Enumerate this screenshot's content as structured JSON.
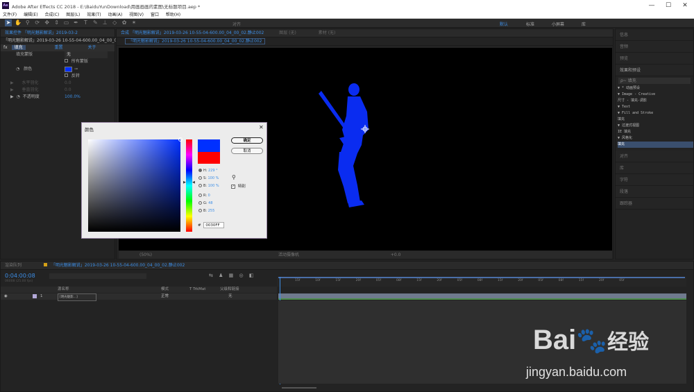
{
  "window": {
    "title": "Adobe After Effects CC 2018 - E:\\BaiduYunDownload\\用画画画的素图\\无标题项目.aep *",
    "minimize": "—",
    "maximize": "☐",
    "close": "✕"
  },
  "menu": [
    "文件(F)",
    "编辑(E)",
    "合成(C)",
    "图层(L)",
    "效果(T)",
    "动画(A)",
    "视图(V)",
    "窗口",
    "帮助(H)"
  ],
  "toolbar": {
    "icons": [
      "arrow-icon",
      "hand-icon",
      "zoom-icon",
      "orbit-icon",
      "pan-icon",
      "dolly-icon",
      "rect-icon",
      "pen-icon",
      "text-icon",
      "brush-icon",
      "stamp-icon",
      "eraser-icon",
      "roto-icon",
      "puppet-icon"
    ],
    "snap_label": "对齐",
    "workspaces": [
      "默认",
      "标准",
      "小屏幕",
      "库"
    ]
  },
  "effects_panel": {
    "tab": "效果控件 「明光魅影解说」2019-03-2",
    "layer": "「明光魅影解说」2019-03-26 10-55-04-600.00_04_00_02.静止",
    "effect_name": "填充",
    "reset": "重置",
    "about": "关于",
    "rows": [
      {
        "label": "填充蒙版",
        "value": "无"
      },
      {
        "label": "",
        "value": "所有蒙版"
      },
      {
        "label": "颜色",
        "value": ""
      },
      {
        "label": "",
        "value": "反转"
      },
      {
        "label": "水平羽化",
        "value": "0.0"
      },
      {
        "label": "垂直羽化",
        "value": "0.0"
      },
      {
        "label": "不透明度",
        "value": "100.0%"
      }
    ]
  },
  "composition": {
    "tab": "合成 「明光魅影解说」2019-03-26 10-55-04-600.00_04_00_02.静止002",
    "layer_tab": "图层 (无)",
    "footage_tab": "素材 (无)",
    "subtab": "「明光魅影解说」2019-03-26 10-55-04-600.00_04_00_02.静止002",
    "zoom": "(50%)",
    "bottom_text": "活动摄像机",
    "plus": "+0.0"
  },
  "color_dialog": {
    "title": "颜色",
    "close": "✕",
    "ok": "确定",
    "cancel": "取消",
    "new_color": "#0030FF",
    "old_color": "#FF0000",
    "fields": [
      {
        "label": "H:",
        "value": "229 °"
      },
      {
        "label": "S:",
        "value": "100 %"
      },
      {
        "label": "B:",
        "value": "100 %"
      },
      {
        "label": "R:",
        "value": "0"
      },
      {
        "label": "G:",
        "value": "48"
      },
      {
        "label": "B:",
        "value": "255"
      }
    ],
    "hex_prefix": "#",
    "hex": "0030FF",
    "web_only": "特别"
  },
  "right_panels": {
    "top": [
      "信息",
      "音频",
      "预览",
      "效果和预设"
    ],
    "search": "ρ~ 填充",
    "tree": [
      "▼ * 动画预设",
      "  ▼ Image - Creative",
      "      尺寸 - 填充-调影",
      "  ▼ Text",
      "    ▼ Fill and Stroke",
      "      填充",
      "▼ 过渡式视图",
      "   IE 填充",
      "▼ 风格化",
      "   填充"
    ],
    "bottom": [
      "对齐",
      "库",
      "字符",
      "段落",
      "跟踪器"
    ]
  },
  "timeline": {
    "tab_render": "渲染队列",
    "tab_comp": "「明光魅影解说」2019-03-26 10-55-04-600.00_04_00_02.静止002",
    "time": "0:04:00:08",
    "fps": "06008 (25.00 fps)",
    "col_name": "源名称",
    "col_mode": "模式",
    "col_trkmat": "T TrkMat",
    "col_parent": "父级和链接",
    "layer_num": "1",
    "layer_name": "[明光魅影...]",
    "layer_mode": "正常",
    "layer_parent": "无",
    "ticks": [
      "15f",
      "10f",
      "15f",
      "20f",
      "05f",
      "08f",
      "15f",
      "20f",
      "05f",
      "08f",
      "15f",
      "20f",
      "05f",
      "08f",
      "15f",
      "20f",
      "05f"
    ]
  },
  "watermark": {
    "brand": "Bai",
    "brand2": "经验",
    "url": "jingyan.baidu.com"
  }
}
